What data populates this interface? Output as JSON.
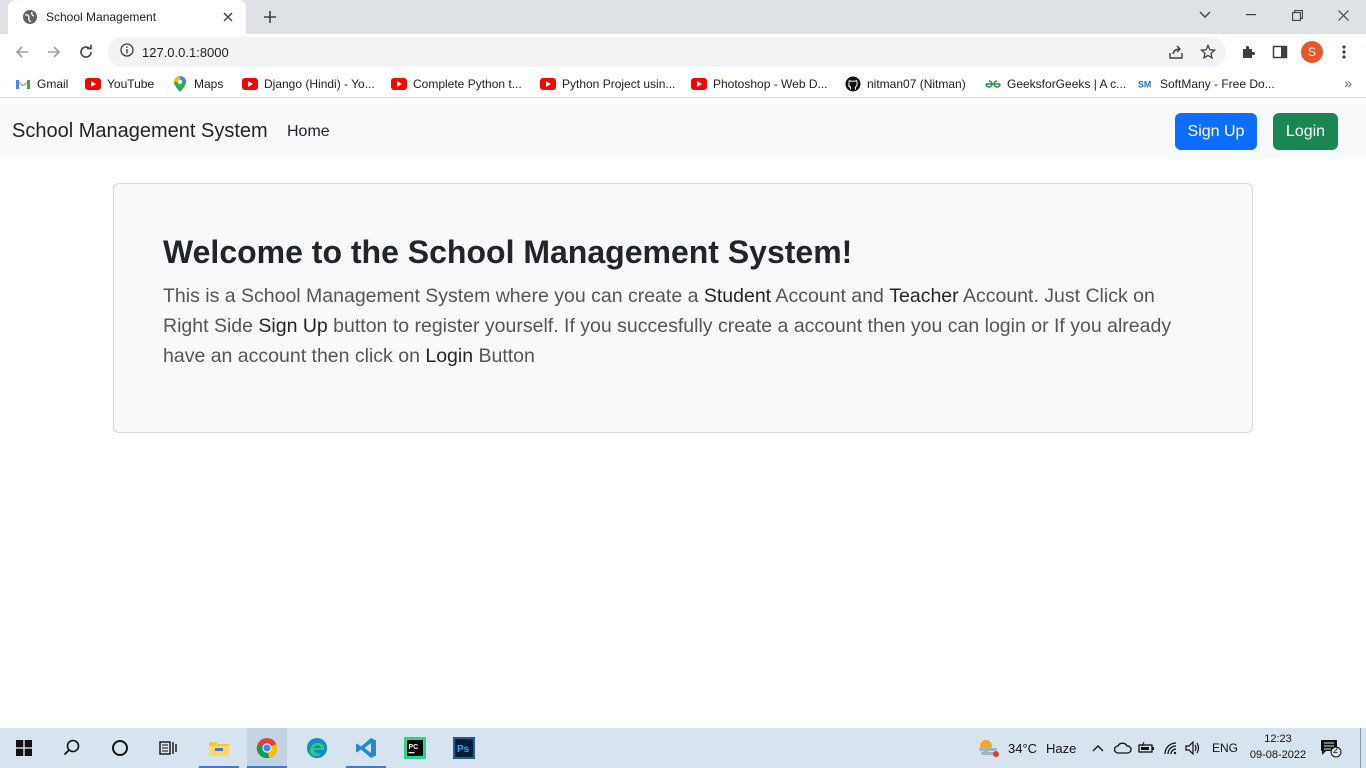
{
  "browser": {
    "tab_title": "School Management",
    "url": "127.0.0.1:8000",
    "profile_initial": "S",
    "bookmarks": [
      {
        "label": "Gmail",
        "icon": "gmail-icon"
      },
      {
        "label": "YouTube",
        "icon": "youtube-icon"
      },
      {
        "label": "Maps",
        "icon": "maps-icon"
      },
      {
        "label": "Django (Hindi) - Yo...",
        "icon": "youtube-icon"
      },
      {
        "label": "Complete Python t...",
        "icon": "youtube-icon"
      },
      {
        "label": "Python Project usin...",
        "icon": "youtube-icon"
      },
      {
        "label": "Photoshop - Web D...",
        "icon": "youtube-icon"
      },
      {
        "label": "nitman07 (Nitman)",
        "icon": "github-icon"
      },
      {
        "label": "GeeksforGeeks | A c...",
        "icon": "gfg-icon"
      },
      {
        "label": "SoftMany - Free Do...",
        "icon": "softmany-icon"
      }
    ],
    "bookmarks_more": "»"
  },
  "page": {
    "brand": "School Management System",
    "nav_home": "Home",
    "signup_label": "Sign Up",
    "login_label": "Login",
    "heading": "Welcome to the School Management System!",
    "body": {
      "p1": "This is a School Management System where you can create a ",
      "student": "Student",
      "p2": " Account and ",
      "teacher": "Teacher",
      "p3": " Account. Just Click on Right Side ",
      "signup": "Sign Up",
      "p4": " button to register yourself. If you succesfully create a account then you can login or If you already have an account then click on ",
      "login": "Login",
      "p5": " Button"
    }
  },
  "taskbar": {
    "weather_temp": "34°C",
    "weather_desc": "Haze",
    "language": "ENG",
    "time": "12:23",
    "date": "09-08-2022",
    "notification_count": "2"
  },
  "colors": {
    "signup_button": "#0d6efd",
    "login_button": "#198754",
    "navbar_bg": "#f8f9fa",
    "jumbotron_bg": "#f8f9fa",
    "profile_avatar": "#e8562a"
  }
}
